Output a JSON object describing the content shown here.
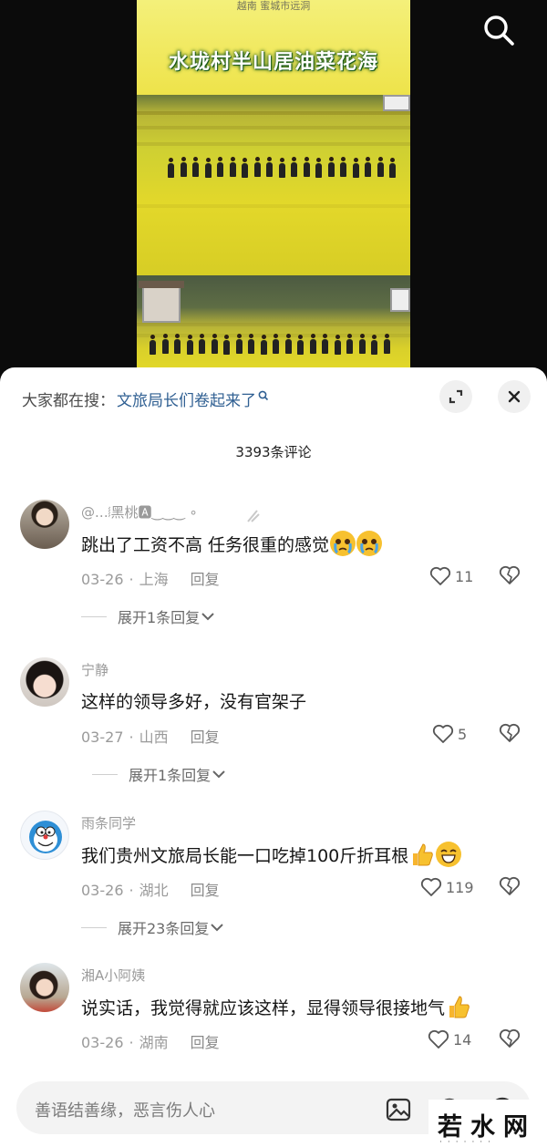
{
  "video": {
    "banner_top_text": "越南  蜜城市远洞",
    "banner_title": "水垅村半山居油菜花海"
  },
  "sheet": {
    "trending_label": "大家都在搜：",
    "trending_link": "文旅局长们卷起来了",
    "comment_count": "3393条评论"
  },
  "comments": [
    {
      "user": "@.‥𝆃黑桃🅰‿‿‿ ∘",
      "text": "跳出了工资不高 任务很重的感觉",
      "date": "03-26",
      "location": "上海",
      "reply_label": "回复",
      "likes": "11",
      "expand": "展开1条回复"
    },
    {
      "user": "宁静",
      "text": "这样的领导多好，没有官架子",
      "date": "03-27",
      "location": "山西",
      "reply_label": "回复",
      "likes": "5",
      "expand": "展开1条回复"
    },
    {
      "user": "雨条同学",
      "text": "我们贵州文旅局长能一口吃掉100斤折耳根",
      "date": "03-26",
      "location": "湖北",
      "reply_label": "回复",
      "likes": "119",
      "expand": "展开23条回复"
    },
    {
      "user": "湘A小阿姨",
      "text": "说实话，我觉得就应该这样，显得领导很接地气",
      "date": "03-26",
      "location": "湖南",
      "reply_label": "回复",
      "likes": "14"
    }
  ],
  "composer": {
    "placeholder": "善语结善缘，恶言伤人心"
  },
  "watermark": {
    "text": "若水网",
    "dots": "·······"
  },
  "colors": {
    "link_blue": "#2f5f92",
    "meta_gray": "#9a9a9a",
    "emoji_yellow": "#f7c12f"
  }
}
